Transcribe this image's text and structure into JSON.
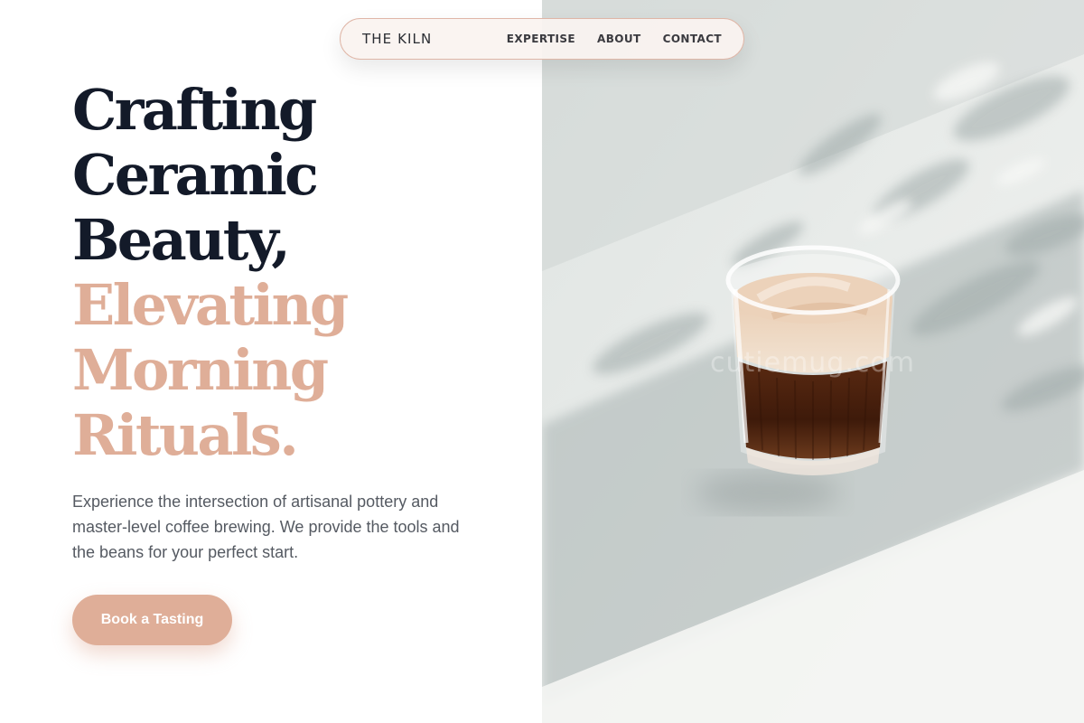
{
  "nav": {
    "brand": "THE KILN",
    "links": [
      "EXPERTISE",
      "ABOUT",
      "CONTACT"
    ]
  },
  "hero": {
    "headline_dark": [
      "Crafting",
      "Ceramic",
      "Beauty,"
    ],
    "headline_accent": [
      "Elevating",
      "Morning",
      "Rituals."
    ],
    "subtext": "Experience the intersection of artisanal pottery and master-level coffee brewing. We provide the tools and the beans for your perfect start.",
    "cta_label": "Book a Tasting",
    "image_watermark": "cutiemug.com"
  },
  "colors": {
    "headline_dark": "#131a29",
    "accent": "#dfae98",
    "body_text": "#555a62",
    "nav_background": "#faf3f0",
    "nav_border": "#dfb6a7"
  },
  "icons": {
    "hero_image": "coffee-glass-photo"
  }
}
